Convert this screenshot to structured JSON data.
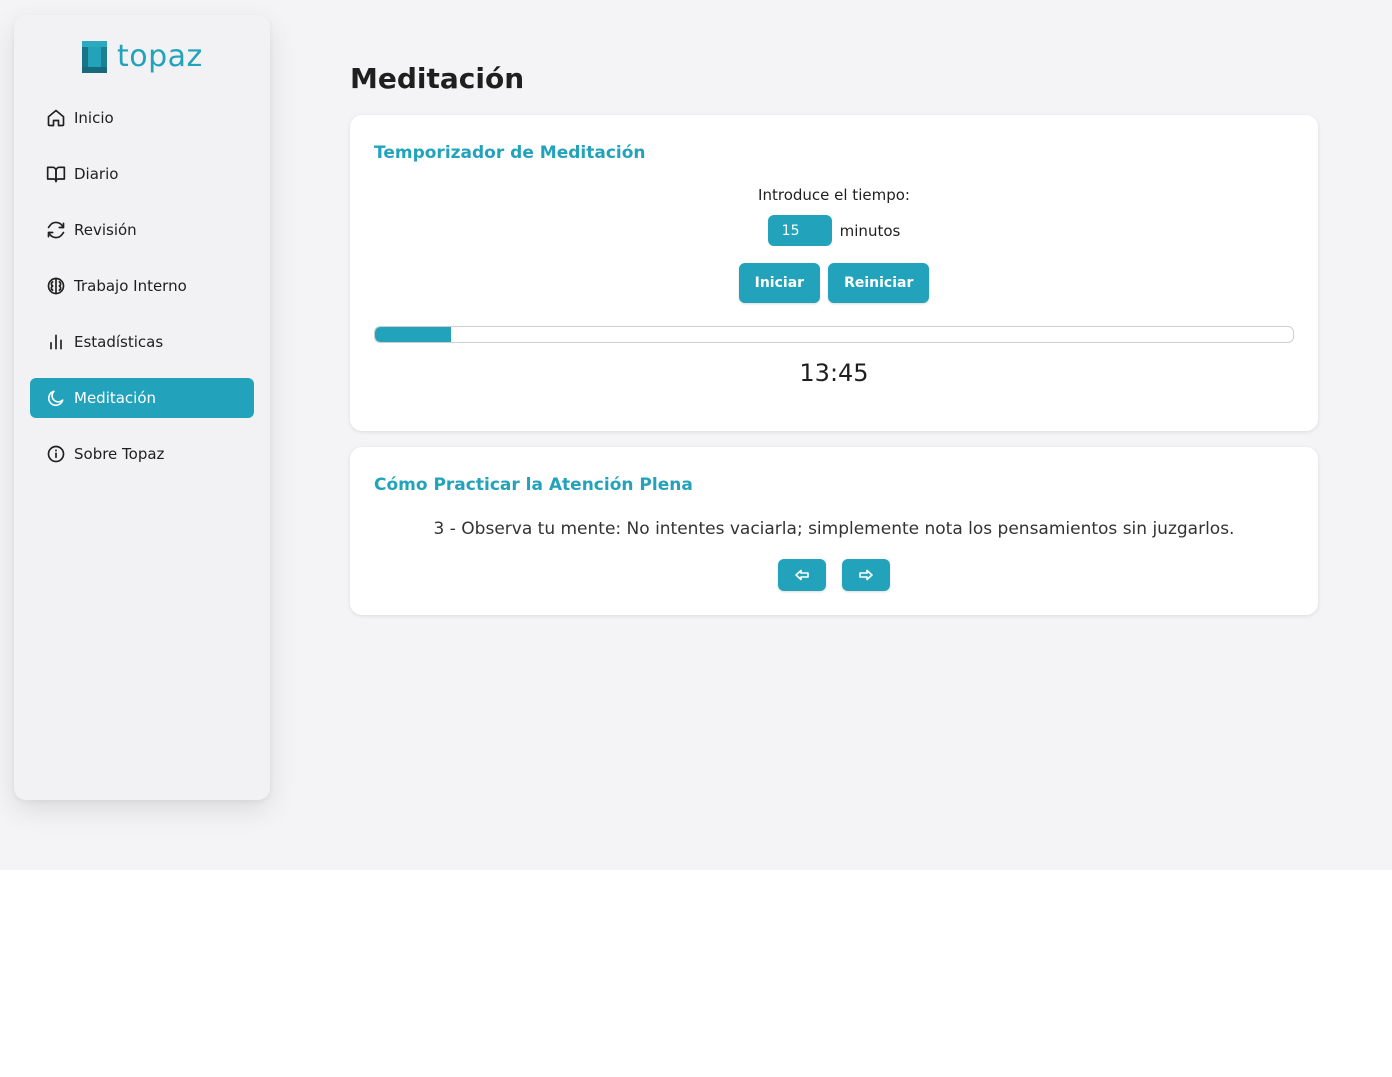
{
  "brand": {
    "name": "topaz",
    "color": "#23a3bb"
  },
  "sidebar": {
    "items": [
      {
        "label": "Inicio",
        "icon": "home-icon",
        "active": false
      },
      {
        "label": "Diario",
        "icon": "book-icon",
        "active": false
      },
      {
        "label": "Revisión",
        "icon": "refresh-icon",
        "active": false
      },
      {
        "label": "Trabajo Interno",
        "icon": "brain-icon",
        "active": false
      },
      {
        "label": "Estadísticas",
        "icon": "bar-chart-icon",
        "active": false
      },
      {
        "label": "Meditación",
        "icon": "moon-icon",
        "active": true
      },
      {
        "label": "Sobre Topaz",
        "icon": "info-icon",
        "active": false
      }
    ]
  },
  "page": {
    "title": "Meditación"
  },
  "timer": {
    "title": "Temporizador de Meditación",
    "prompt": "Introduce el tiempo:",
    "minutes_value": "15",
    "minutes_unit": "minutos",
    "start_label": "Iniciar",
    "reset_label": "Reiniciar",
    "progress_fraction": 0.083,
    "remaining": "13:45"
  },
  "tips": {
    "title": "Cómo Practicar la Atención Plena",
    "current_tip": "3 - Observa tu mente: No intentes vaciarla; simplemente nota los pensamientos sin juzgarlos.",
    "prev_icon": "arrow-left-icon",
    "next_icon": "arrow-right-icon"
  }
}
